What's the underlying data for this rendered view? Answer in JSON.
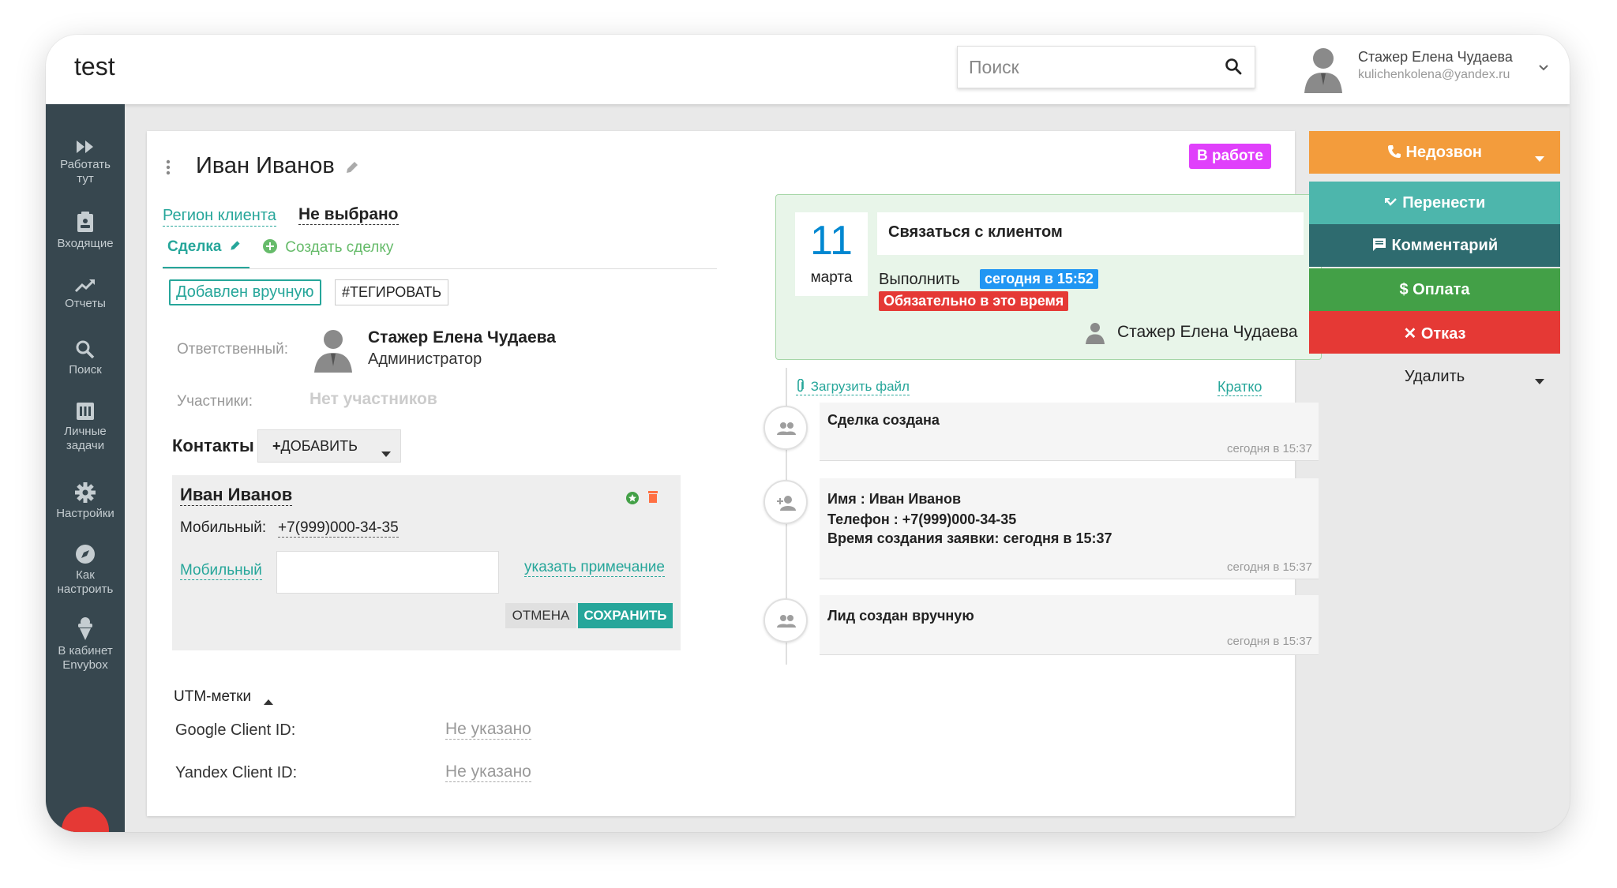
{
  "app": {
    "title": "test"
  },
  "search": {
    "placeholder": "Поиск"
  },
  "user": {
    "name": "Стажер Елена Чудаева",
    "email": "kulichenkolena@yandex.ru"
  },
  "sidebar": {
    "items": [
      {
        "label": "Работать\nтут",
        "icon": "fast-forward-icon"
      },
      {
        "label": "Входящие",
        "icon": "inbox-icon"
      },
      {
        "label": "Отчеты",
        "icon": "trending-up-icon"
      },
      {
        "label": "Поиск",
        "icon": "search-icon"
      },
      {
        "label": "Личные\nзадачи",
        "icon": "tasks-icon"
      },
      {
        "label": "Настройки",
        "icon": "gear-icon"
      },
      {
        "label": "Как\nнастроить",
        "icon": "compass-icon"
      },
      {
        "label": "В кабинет\nEnvybox",
        "icon": "ice-cream-icon"
      }
    ]
  },
  "deal": {
    "name": "Иван Иванов",
    "status": "В работе",
    "region_label": "Регион клиента",
    "region_value": "Не выбрано",
    "tab_deal": "Сделка",
    "tab_create": "Создать сделку",
    "tag_manual": "Добавлен вручную",
    "tag_hash": "#ТЕГИРОВАТЬ",
    "responsible_label": "Ответственный:",
    "responsible_name": "Стажер Елена Чудаева",
    "responsible_role": "Администратор",
    "participants_label": "Участники:",
    "participants_value": "Нет участников",
    "contacts_label": "Контакты",
    "add_button": "ДОБАВИТЬ",
    "contact": {
      "name": "Иван Иванов",
      "phone_label": "Мобильный:",
      "phone": "+7(999)000-34-35",
      "phone_type": "Мобильный",
      "note_link": "указать примечание",
      "cancel": "ОТМЕНА",
      "save": "СОХРАНИТЬ"
    },
    "utm": {
      "label": "UTM-метки",
      "google_label": "Google Client ID:",
      "google_value": "Не указано",
      "yandex_label": "Yandex Client ID:",
      "yandex_value": "Не указано"
    }
  },
  "task": {
    "day": "11",
    "month": "марта",
    "title": "Связаться с клиентом",
    "do_label": "Выполнить",
    "when": "сегодня в 15:52",
    "strict": "Обязательно в это время",
    "user": "Стажер Елена Чудаева"
  },
  "timeline": {
    "upload": "Загрузить файл",
    "brief": "Кратко",
    "entries": [
      {
        "lines": [
          "Сделка создана"
        ],
        "time": "сегодня в 15:37",
        "icon": "people-icon"
      },
      {
        "lines": [
          "Имя : Иван Иванов",
          "Телефон : +7(999)000-34-35",
          "Время создания заявки: сегодня в 15:37"
        ],
        "time": "сегодня в 15:37",
        "icon": "person-add-icon"
      },
      {
        "lines": [
          "Лид создан вручную"
        ],
        "time": "сегодня в 15:37",
        "icon": "people-icon"
      }
    ]
  },
  "actions": {
    "nodial": "Недозвон",
    "move": "Перенести",
    "comment": "Комментарий",
    "pay": "Оплата",
    "refuse": "Отказ",
    "delete": "Удалить"
  },
  "colors": {
    "accent": "#26a69a",
    "sidebar": "#37474f",
    "status_badge": "#e040fb",
    "nodial": "#f39c3c",
    "move": "#4db6ac",
    "comment": "#2e6b6f",
    "pay": "#43a047",
    "refuse": "#e53935",
    "task_when": "#2196f3"
  }
}
